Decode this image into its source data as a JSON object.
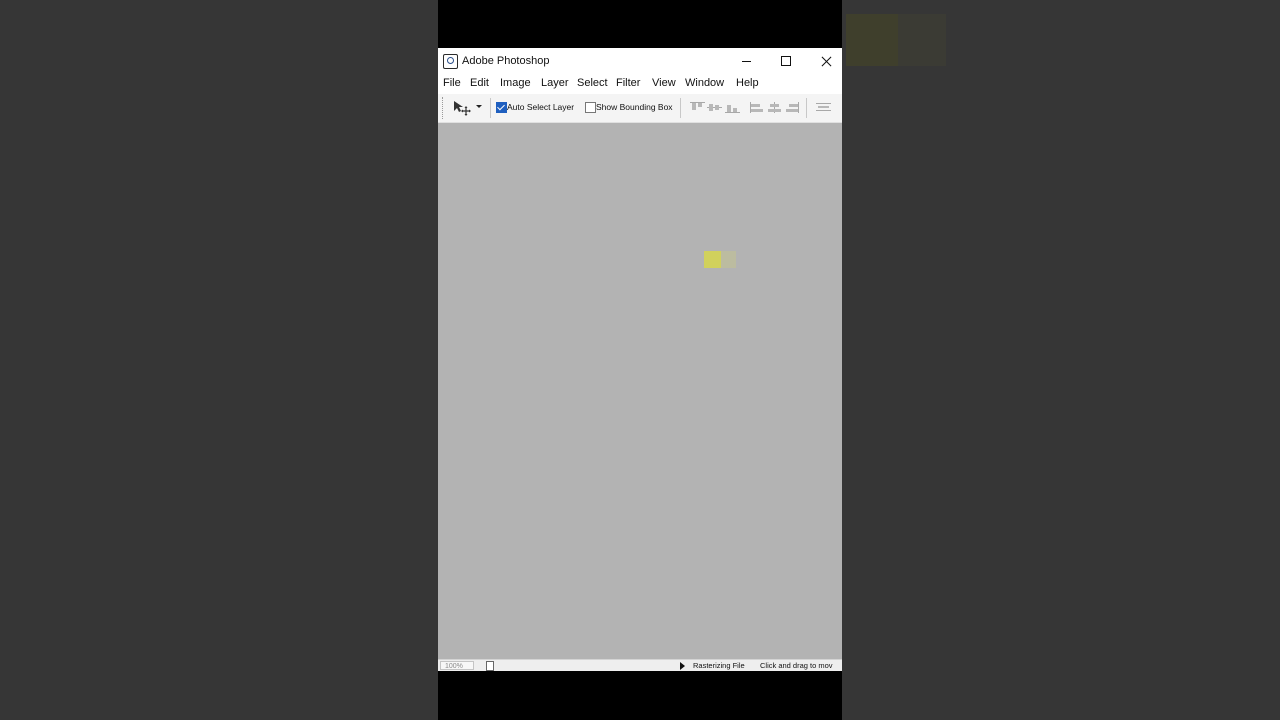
{
  "window": {
    "title": "Adobe Photoshop",
    "controls": {
      "minimize_icon": "minimize-icon",
      "maximize_icon": "maximize-icon",
      "close_icon": "close-icon"
    }
  },
  "menubar": {
    "items": [
      "File",
      "Edit",
      "Image",
      "Layer",
      "Select",
      "Filter",
      "View",
      "Window",
      "Help"
    ]
  },
  "options_bar": {
    "tool_icon": "move-tool-icon",
    "auto_select": {
      "label": "Auto Select Layer",
      "checked": true
    },
    "bounding_box": {
      "label": "Show Bounding Box",
      "checked": false
    },
    "align_icons": [
      "align-top-edges-icon",
      "align-vertical-centers-icon",
      "align-bottom-edges-icon",
      "align-left-edges-icon",
      "align-horizontal-centers-icon",
      "align-right-edges-icon",
      "distribute-icon"
    ]
  },
  "canvas": {
    "background_color": "#b3b3b3",
    "swatch_colors": [
      "#d1d15c",
      "#bcbca0"
    ]
  },
  "statusbar": {
    "zoom": "100%",
    "progress_label": "Rasterizing File",
    "hint": "Click and drag to mov"
  },
  "colors": {
    "checkbox_accent": "#1f5fbf",
    "page_background": "#363636"
  }
}
